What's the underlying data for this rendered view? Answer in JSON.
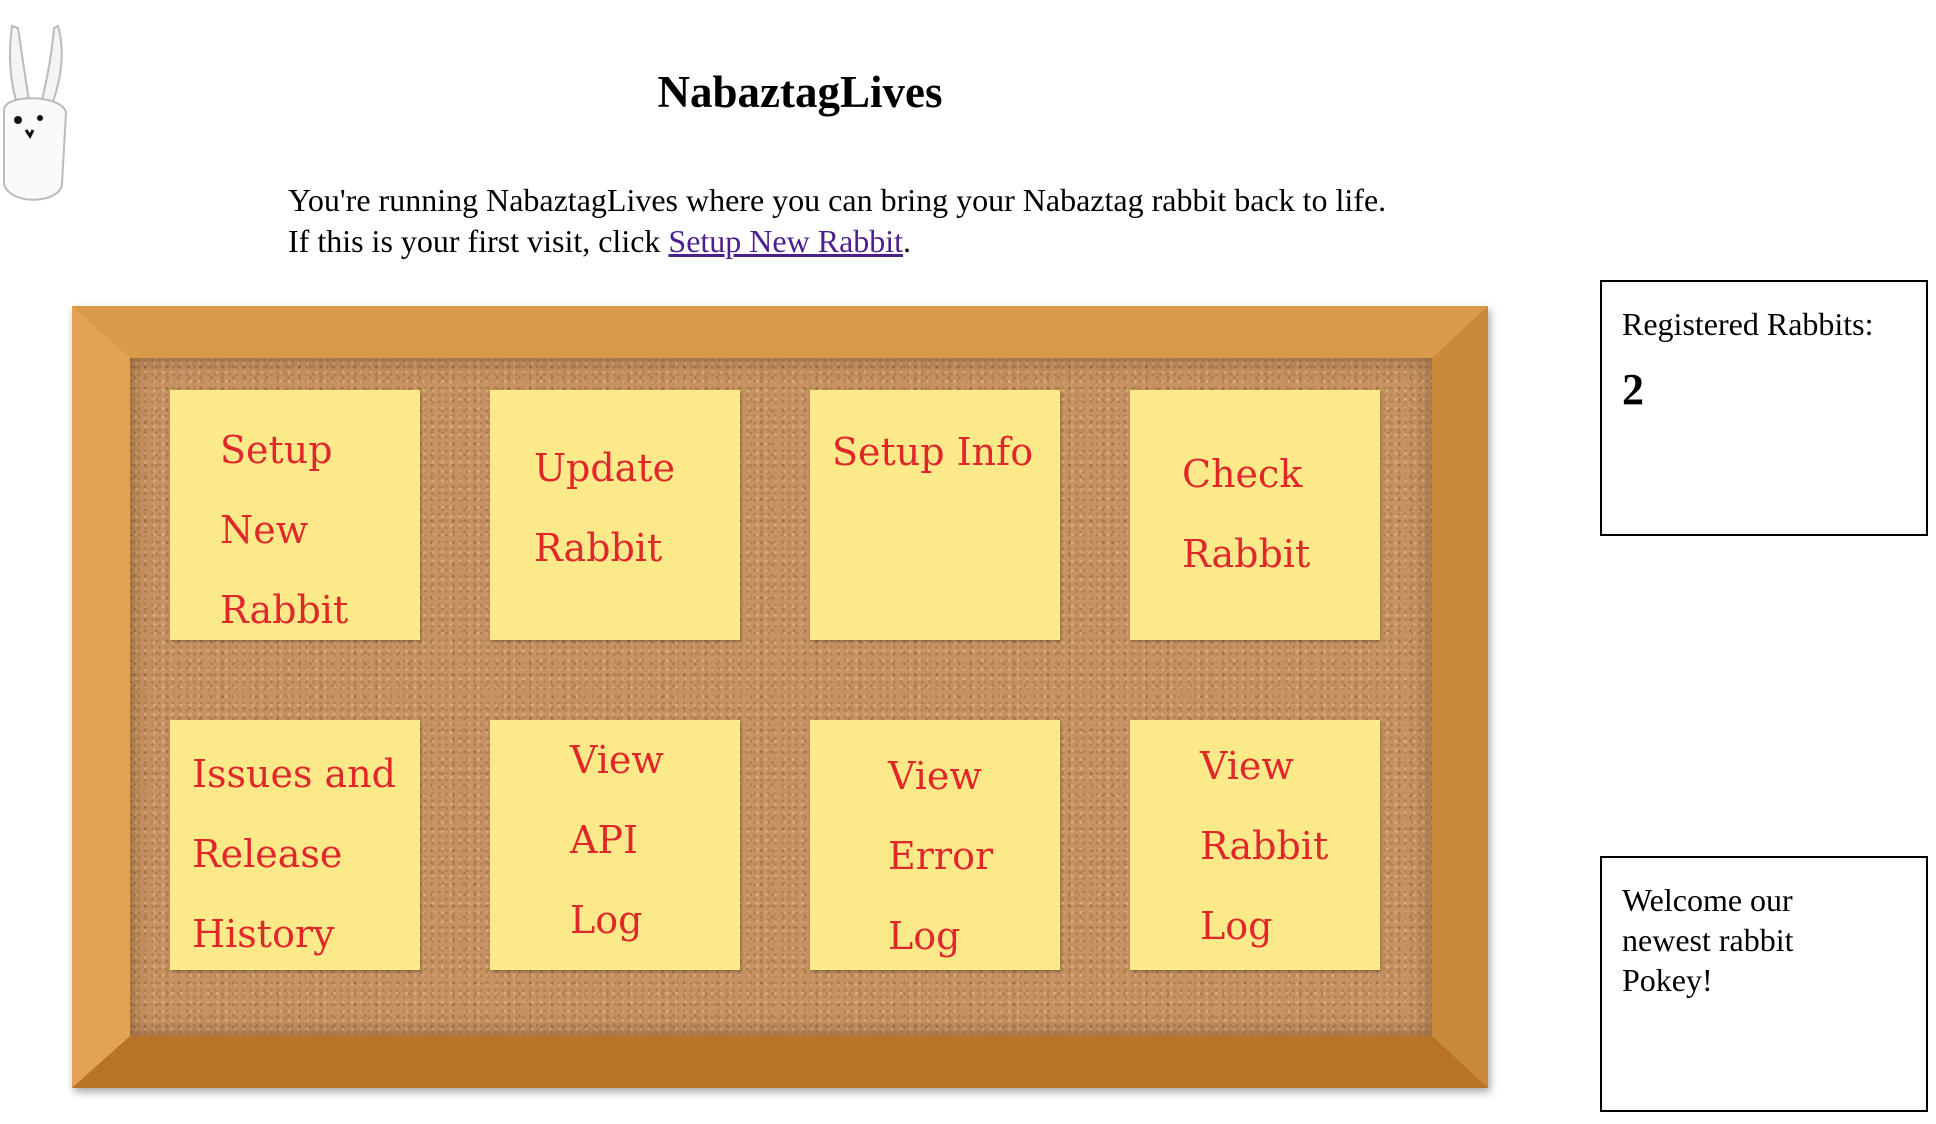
{
  "header": {
    "title": "NabaztagLives"
  },
  "intro": {
    "line1": "You're running NabaztagLives where you can bring your Nabaztag rabbit back to life.",
    "line2_prefix": "If this is your first visit, click ",
    "line2_link": "Setup New Rabbit",
    "line2_suffix": "."
  },
  "notes": [
    {
      "lines": [
        "Setup",
        "New",
        "Rabbit"
      ]
    },
    {
      "lines": [
        "Update",
        "Rabbit"
      ]
    },
    {
      "lines": [
        "Setup Info"
      ]
    },
    {
      "lines": [
        "Check",
        "Rabbit"
      ]
    },
    {
      "lines": [
        "Issues and",
        "Release",
        "History"
      ]
    },
    {
      "lines": [
        "View",
        "API",
        "Log"
      ]
    },
    {
      "lines": [
        "View",
        "Error",
        "Log"
      ]
    },
    {
      "lines": [
        "View",
        "Rabbit",
        "Log"
      ]
    }
  ],
  "sidebar": {
    "registered_label": "Registered Rabbits:",
    "registered_count": "2",
    "welcome_line1": "Welcome our",
    "welcome_line2": "newest rabbit",
    "welcome_line3": "Pokey!"
  },
  "colors": {
    "note_bg": "#fbe98a",
    "note_text": "#e0282a",
    "link": "#4b1f8c",
    "cork": "#c69262",
    "frame": "#d99a4a"
  },
  "icons": {
    "logo": "nabaztag-rabbit-icon"
  }
}
